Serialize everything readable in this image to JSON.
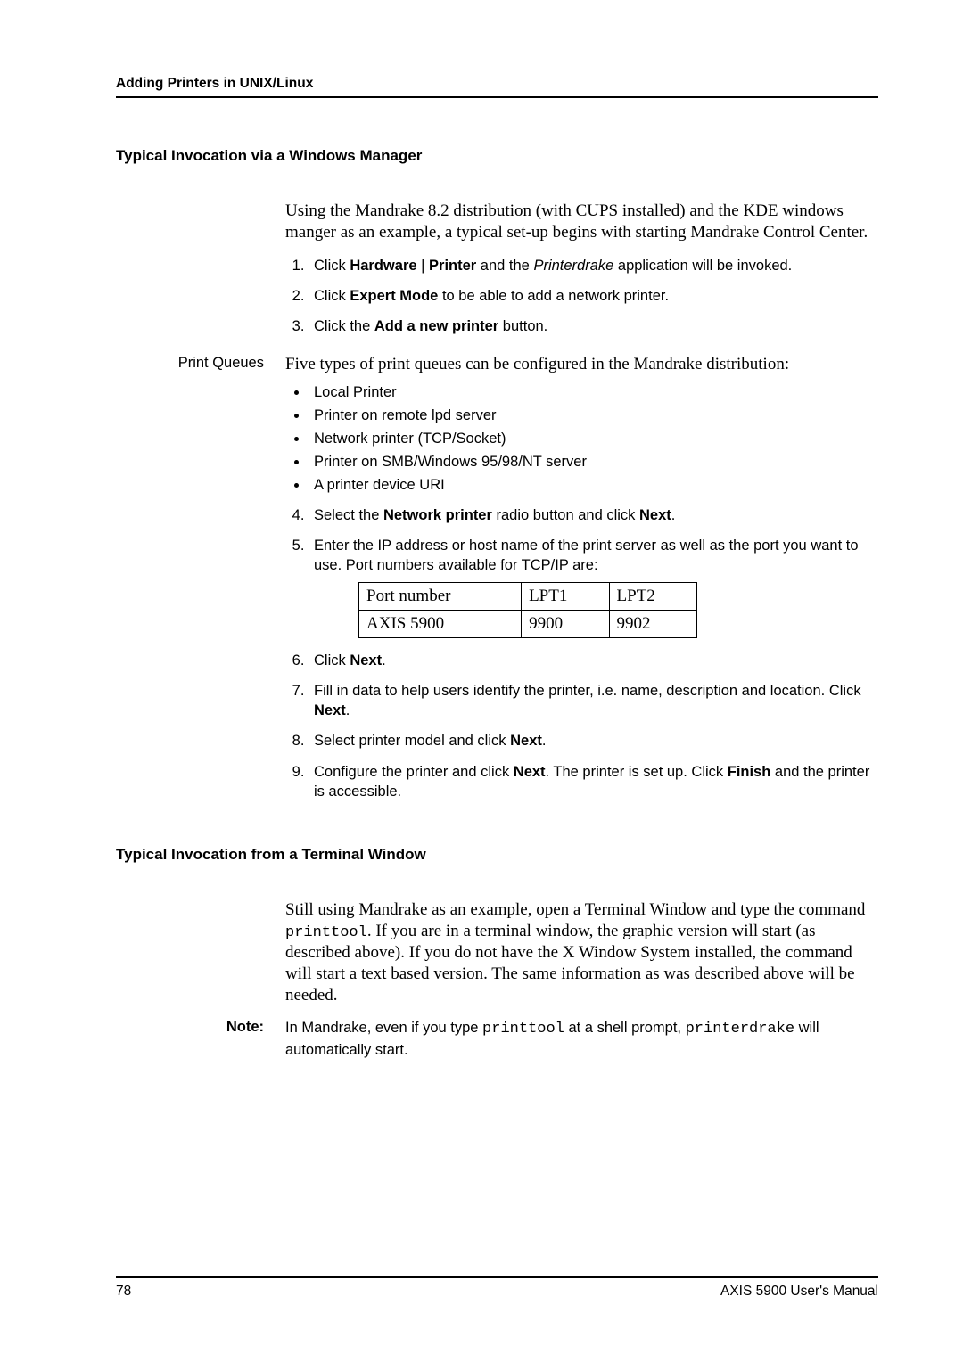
{
  "header": "Adding Printers in UNIX/Linux",
  "sec1_title": "Typical Invocation via a Windows Manager",
  "sec1_intro": "Using the Mandrake 8.2 distribution (with CUPS installed) and the KDE windows manger as an example, a typical set-up begins with starting Mandrake Control Center.",
  "step1_pre": "Click ",
  "step1_b1": "Hardware",
  "step1_mid": " | ",
  "step1_b2": "Printer",
  "step1_post1": " and the ",
  "step1_i": "Printerdrake",
  "step1_post2": " application will be invoked.",
  "step2_pre": "Click ",
  "step2_b": "Expert Mode",
  "step2_post": " to be able to add a network printer.",
  "step3_pre": "Click the ",
  "step3_b": "Add a new printer",
  "step3_post": " button.",
  "pq_label": "Print Queues",
  "pq_intro": "Five types of print queues can be configured in the Mandrake distribution:",
  "bul1": "Local Printer",
  "bul2": "Printer on remote lpd server",
  "bul3": "Network printer (TCP/Socket)",
  "bul4": "Printer on SMB/Windows 95/98/NT server",
  "bul5": "A printer device URI",
  "step4_pre": "Select the ",
  "step4_b": "Network printer",
  "step4_mid": " radio button and click ",
  "step4_b2": "Next",
  "step5": "Enter the IP address or host name of the print server as well as the port you want to use. Port numbers available for TCP/IP are:",
  "tbl_h0": "Port number",
  "tbl_h1": "LPT1",
  "tbl_h2": "LPT2",
  "tbl_r0": "AXIS 5900",
  "tbl_r1": "9900",
  "tbl_r2": "9902",
  "step6_pre": "Click ",
  "step6_b": "Next",
  "step7_pre": "Fill in data to help users identify the printer, i.e. name, description and location. Click ",
  "step7_b": "Next",
  "step8_pre": "Select printer model and click ",
  "step8_b": "Next",
  "step9_pre": "Configure the printer and click ",
  "step9_b1": "Next",
  "step9_mid": ". The printer is set up. Click ",
  "step9_b2": "Finish",
  "step9_post": " and the printer is accessible.",
  "sec2_title": "Typical Invocation from a Terminal Window",
  "sec2_p1a": "Still using Mandrake as an example, open a Terminal Window and type the command ",
  "sec2_code1": "printtool",
  "sec2_p1b": ". If you are in a terminal window, the graphic version will start (as described above). If you do not have the X Window System installed, the command will start a text based version. The same information as was described above will be needed.",
  "note_label": "Note:",
  "note_a": "In Mandrake, even if you type ",
  "note_code1": "printtool",
  "note_b": " at a shell prompt, ",
  "note_code2": "printerdrake",
  "note_c": " will automatically start.",
  "page_num": "78",
  "footer_right": "AXIS 5900 User's Manual"
}
